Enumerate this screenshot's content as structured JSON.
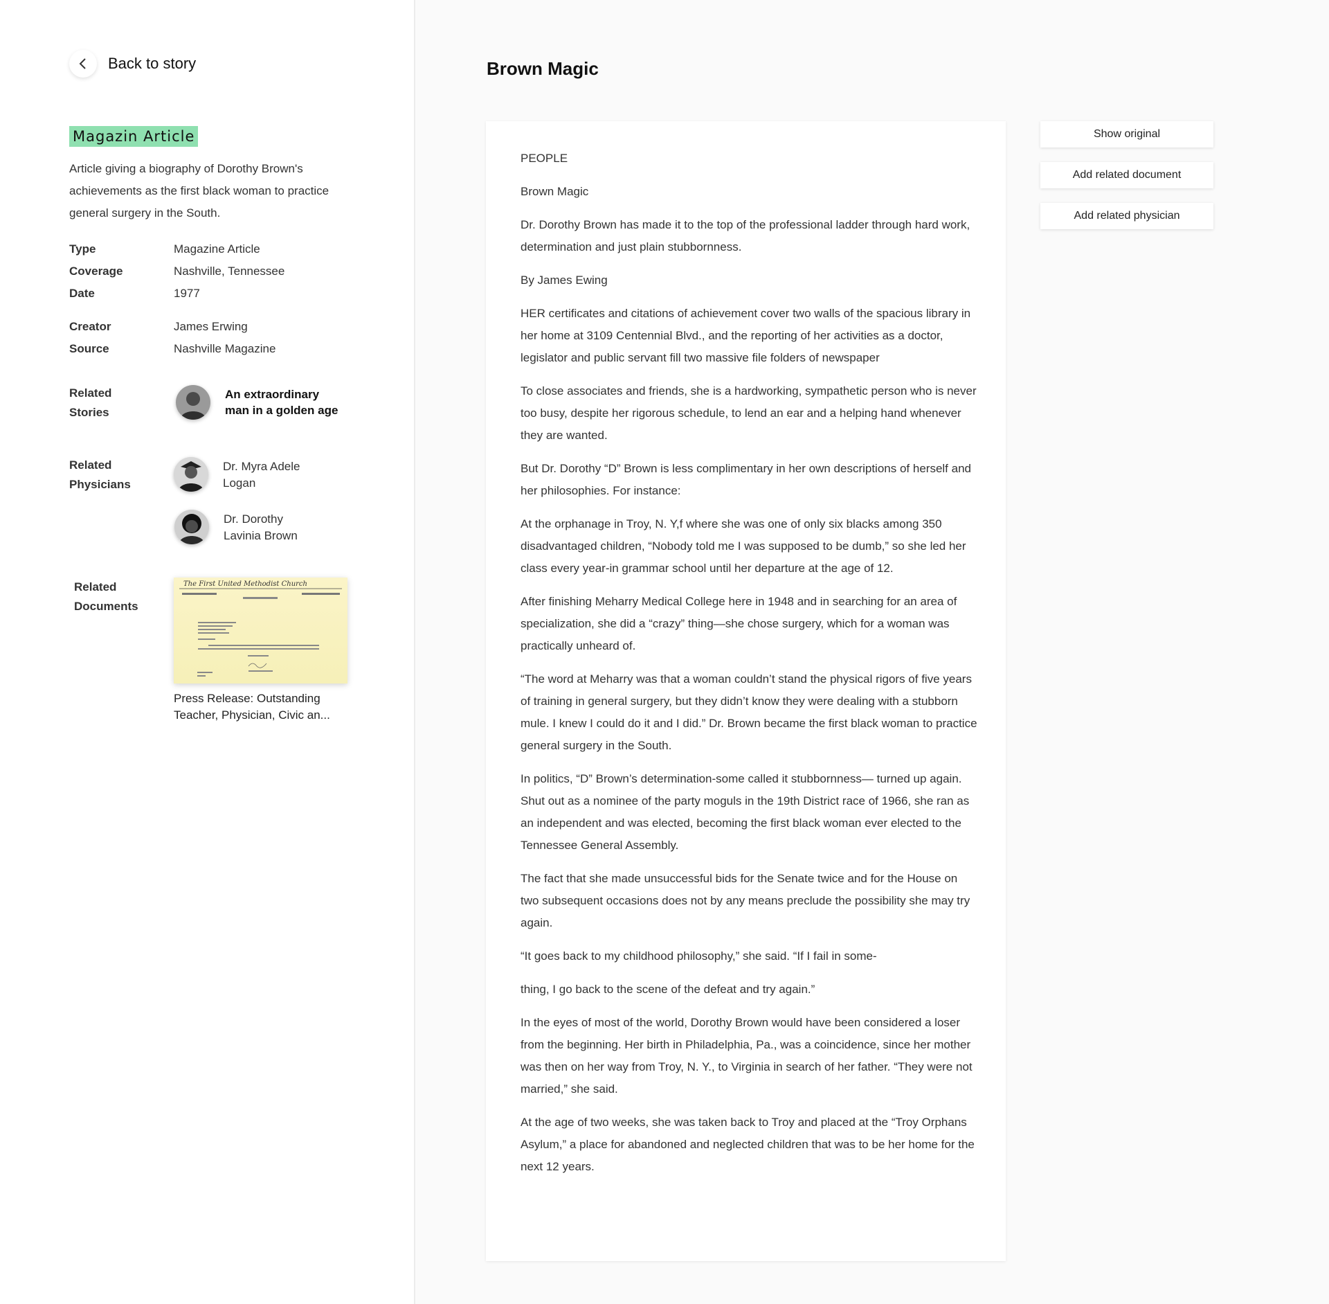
{
  "back": {
    "label": "Back to story"
  },
  "tag": "Magazin Article",
  "description": "Article giving a biography of Dorothy Brown's achievements as the first black woman to practice general surgery in the South.",
  "meta": [
    {
      "key": "Type",
      "value": "Magazine Article"
    },
    {
      "key": "Coverage",
      "value": "Nashville, Tennessee"
    },
    {
      "key": "Date",
      "value": "1977"
    },
    {
      "key": "Creator",
      "value": "James Erwing"
    },
    {
      "key": "Source",
      "value": "Nashville Magazine"
    }
  ],
  "related_stories": {
    "label_line1": "Related",
    "label_line2": "Stories",
    "items": [
      {
        "title_line1": "An extraordinary",
        "title_line2": "man in a golden age"
      }
    ]
  },
  "related_physicians": {
    "label_line1": "Related",
    "label_line2": "Physicians",
    "items": [
      {
        "name_line1": "Dr. Myra Adele",
        "name_line2": "Logan"
      },
      {
        "name_line1": "Dr. Dorothy",
        "name_line2": "Lavinia Brown"
      }
    ]
  },
  "related_documents": {
    "label_line1": "Related",
    "label_line2": "Documents",
    "items": [
      {
        "caption_line1": "Press Release: Outstanding",
        "caption_line2": "Teacher, Physician, Civic an...",
        "letterhead": "The First United Methodist Church"
      }
    ]
  },
  "main": {
    "title": "Brown Magic",
    "paragraphs": [
      "PEOPLE",
      "Brown Magic",
      "Dr. Dorothy Brown has made it to the top of the professional ladder through hard work, determination and just plain stubbornness.",
      "By James Ewing",
      "HER certificates and citations of achievement cover two walls of the spacious library in her home at 3109 Centennial Blvd., and the reporting of her activities as a doctor, legislator and public servant fill two massive file folders of newspaper",
      "To close associates and friends, she is a hardworking, sympathetic person who is never too busy, despite her rigorous schedule, to lend an ear and a helping hand whenever they are wanted.",
      "But Dr. Dorothy “D” Brown is less complimentary in her own descriptions of herself and her philosophies. For instance:",
      "At the orphanage in Troy, N. Y,f where she was one of only six blacks among 350 disadvantaged children, “Nobody told me I was supposed to be dumb,” so she led her class every year-in grammar school until her departure at the age of 12.",
      "After finishing Meharry Medical College here in 1948 and in searching for an area of specialization, she did a “crazy” thing—she chose surgery, which for a woman was practically unheard of.",
      "“The word at Meharry was that a woman couldn’t stand the physical rigors of five years of training in general surgery, but they didn’t know they were dealing with a stubborn mule. I knew I could do it and I did.” Dr. Brown became the first black woman to practice general surgery in the South.",
      "In politics, “D” Brown’s determination-some called it stubbornness— turned up again. Shut out as a nominee of the party moguls in the 19th District race of 1966, she ran as an independent and was elected, becoming the first black woman ever elected to the Tennessee General Assembly.",
      "The fact that she made unsuccessful bids for the Senate twice and for the House on two subsequent occasions does not by any means preclude the possibility she may try again.",
      "“It goes back to my childhood philosophy,” she said. “If I fail in some-",
      "thing, I go back to the scene of the defeat and try again.”",
      "In the eyes of most of the world, Dorothy Brown would have been considered a loser from the beginning. Her birth in Philadelphia, Pa., was a coincidence, since her mother was then on her way from Troy, N. Y., to Virginia in search of her father. “They were not married,” she said.",
      "At the age of two weeks, she was taken back to Troy and placed at the “Troy Orphans Asylum,” a place for abandoned and neglected children that was to be her home for the next 12 years."
    ]
  },
  "actions": {
    "show_original": "Show original",
    "add_related_document": "Add related document",
    "add_related_physician": "Add related physician"
  },
  "colors": {
    "tag_highlight": "#8fe0b0"
  }
}
